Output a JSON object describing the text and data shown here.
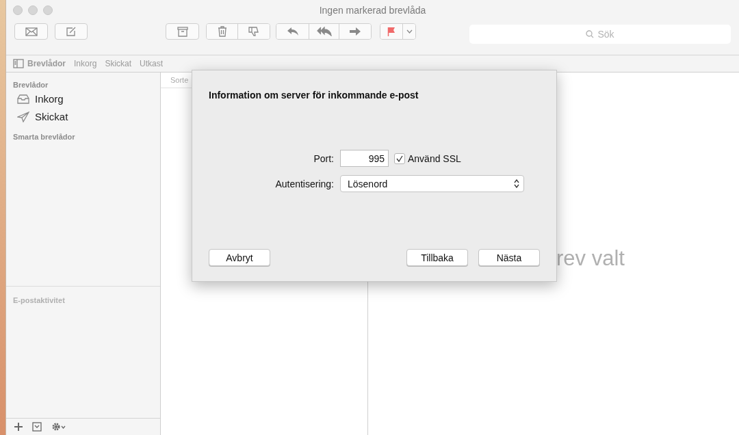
{
  "window": {
    "title": "Ingen markerad brevlåda"
  },
  "search": {
    "placeholder": "Sök"
  },
  "favorites": [
    {
      "label": "Brevlådor",
      "selected": true
    },
    {
      "label": "Inkorg",
      "selected": false
    },
    {
      "label": "Skickat",
      "selected": false
    },
    {
      "label": "Utkast",
      "selected": false
    }
  ],
  "sidebar": {
    "sections": [
      {
        "title": "Brevlådor",
        "items": [
          {
            "label": "Inkorg",
            "kind": "inbox"
          },
          {
            "label": "Skickat",
            "kind": "sent"
          }
        ]
      },
      {
        "title": "Smarta brevlådor"
      }
    ],
    "activity_title": "E-postaktivitet"
  },
  "message_list": {
    "column_header": "Sorte"
  },
  "viewer": {
    "empty_text": "rev valt"
  },
  "dialog": {
    "title": "Information om server för inkommande e-post",
    "port": {
      "label": "Port:",
      "value": "995"
    },
    "ssl": {
      "label": "Använd SSL",
      "checked": true
    },
    "auth": {
      "label": "Autentisering:",
      "value": "Lösenord"
    },
    "buttons": [
      {
        "label": "Avbryt"
      },
      {
        "label": "Tillbaka"
      },
      {
        "label": "Nästa"
      }
    ]
  }
}
